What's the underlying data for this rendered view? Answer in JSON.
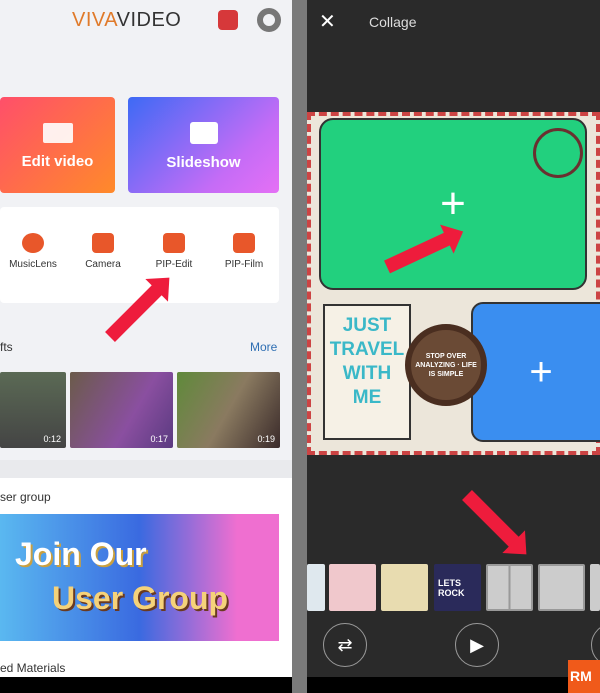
{
  "left_screen": {
    "logo": {
      "part1": "VIVA",
      "part2": "VIDEO"
    },
    "cards": [
      {
        "label": "Edit video"
      },
      {
        "label": "Slideshow"
      }
    ],
    "tools": [
      {
        "label": "MusicLens"
      },
      {
        "label": "Camera"
      },
      {
        "label": "PIP-Edit"
      },
      {
        "label": "PIP-Film"
      }
    ],
    "gifts_section": {
      "title": "fts",
      "more": "More"
    },
    "videos": [
      {
        "duration": "0:12"
      },
      {
        "duration": "0:17"
      },
      {
        "duration": "0:19"
      }
    ],
    "user_group": {
      "title": "ser group",
      "banner_line1": "Join Our",
      "banner_line2": "User Group"
    },
    "materials_title": "ed Materials"
  },
  "right_screen": {
    "title": "Collage",
    "close_icon": "close-icon",
    "collage_text": "JUST TRAVEL WITH ME",
    "wheel_text": "STOP OVER ANALYZING · LIFE IS SIMPLE",
    "filmstrip": [
      {
        "label": ""
      },
      {
        "label": ""
      },
      {
        "label": ""
      },
      {
        "label": "LETS ROCK"
      },
      {
        "label": ""
      },
      {
        "label": ""
      }
    ],
    "watermark": "RM"
  },
  "colors": {
    "accent_red": "#ee1c3c",
    "green_slot": "#22d07e",
    "blue_slot": "#3a8ef0",
    "more_link": "#2f6fb3"
  }
}
